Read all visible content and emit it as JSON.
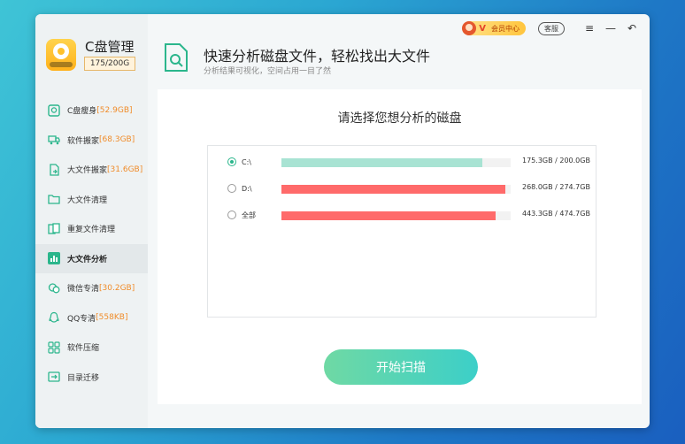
{
  "app": {
    "title": "C盘管理",
    "usage": "175/200G"
  },
  "header": {
    "title": "快速分析磁盘文件，轻松找出大文件",
    "subtitle": "分析结果可视化，空间占用一目了然"
  },
  "topbar": {
    "vip_label": "会员中心",
    "vip_badge": "V",
    "service_label": "客服",
    "menu_icon": "≡",
    "minimize_icon": "—",
    "back_icon": "↶"
  },
  "sidebar": {
    "items": [
      {
        "label": "C盘瘦身",
        "size": "[52.9GB]",
        "icon": "slim-icon",
        "active": false
      },
      {
        "label": "软件搬家",
        "size": "[68.3GB]",
        "icon": "truck-icon",
        "active": false
      },
      {
        "label": "大文件搬家",
        "size": "[31.6GB]",
        "icon": "big-file-move-icon",
        "active": false
      },
      {
        "label": "大文件清理",
        "size": "",
        "icon": "folder-icon",
        "active": false
      },
      {
        "label": "重复文件清理",
        "size": "",
        "icon": "duplicate-icon",
        "active": false
      },
      {
        "label": "大文件分析",
        "size": "",
        "icon": "chart-icon",
        "active": true
      },
      {
        "label": "微信专清",
        "size": "[30.2GB]",
        "icon": "wechat-icon",
        "active": false
      },
      {
        "label": "QQ专清",
        "size": "[558KB]",
        "icon": "qq-icon",
        "active": false
      },
      {
        "label": "软件压缩",
        "size": "",
        "icon": "compress-icon",
        "active": false
      },
      {
        "label": "目录迁移",
        "size": "",
        "icon": "migrate-icon",
        "active": false
      }
    ]
  },
  "panel": {
    "title": "请选择您想分析的磁盘",
    "scan_button": "开始扫描"
  },
  "drives": [
    {
      "name": "C:\\",
      "size": "175.3GB / 200.0GB",
      "used_fraction": 0.8765,
      "selected": true,
      "color": "#a8e3d3"
    },
    {
      "name": "D:\\",
      "size": "268.0GB / 274.7GB",
      "used_fraction": 0.9756,
      "selected": false,
      "color": "#ff6a6a"
    },
    {
      "name": "全部",
      "size": "443.3GB / 474.7GB",
      "used_fraction": 0.9339,
      "selected": false,
      "color": "#ff6a6a"
    }
  ],
  "colors": {
    "accent": "#2bb68c",
    "size_highlight": "#f08c2a",
    "bar_danger": "#ff6a6a",
    "bar_ok": "#a8e3d3"
  }
}
